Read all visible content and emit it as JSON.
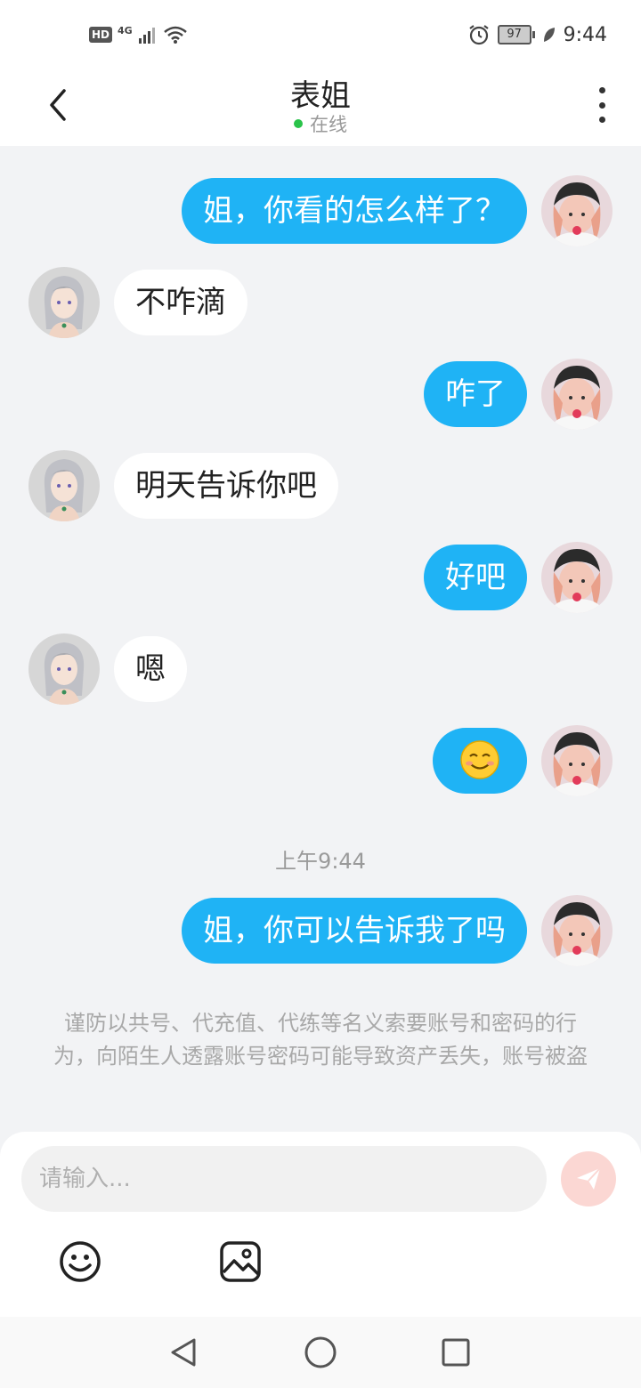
{
  "status_bar": {
    "hd_badge": "HD",
    "network": "4G",
    "battery": "97",
    "time": "9:44",
    "icons": [
      "hd-icon",
      "signal-icon",
      "wifi-icon",
      "alarm-icon",
      "battery-icon",
      "leaf-icon"
    ]
  },
  "header": {
    "title": "表姐",
    "status": "在线",
    "status_color": "#2ac34a",
    "back_icon": "chevron-left-icon",
    "more_icon": "more-vertical-icon"
  },
  "messages": [
    {
      "side": "out",
      "text": "姐，你看的怎么样了？"
    },
    {
      "side": "in",
      "text": "不咋滴"
    },
    {
      "side": "out",
      "text": "咋了"
    },
    {
      "side": "in",
      "text": "明天告诉你吧"
    },
    {
      "side": "out",
      "text": "好吧"
    },
    {
      "side": "in",
      "text": "嗯"
    },
    {
      "side": "out",
      "text": "☺️"
    },
    {
      "side": "out",
      "text": "姐，你可以告诉我了吗"
    }
  ],
  "timestamp": "上午9:44",
  "warning": "谨防以共号、代充值、代练等名义索要账号和密码的行为，向陌生人透露账号密码可能导致资产丢失，账号被盗",
  "input": {
    "placeholder": "请输入..."
  },
  "tools": {
    "emoji_icon": "smiley-icon",
    "image_icon": "image-icon",
    "send_icon": "send-icon"
  },
  "colors": {
    "outgoing_bubble": "#1fb3f5",
    "incoming_bubble": "#ffffff",
    "background": "#f2f3f5",
    "send_button": "#fbd7d3"
  }
}
